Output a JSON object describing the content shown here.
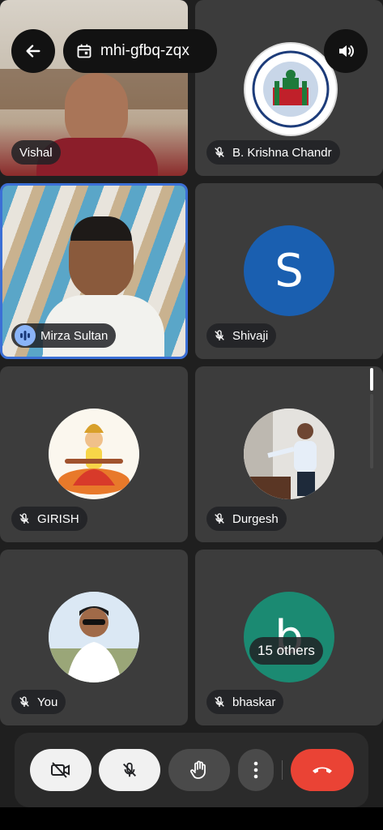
{
  "meeting": {
    "code": "mhi-gfbq-zqx"
  },
  "participants": [
    {
      "name": "Vishal",
      "type": "video"
    },
    {
      "name": "B. Krishna Chandr",
      "type": "logo",
      "muted": true
    },
    {
      "name": "Mirza Sultan",
      "type": "video",
      "speaking": true
    },
    {
      "name": "Shivaji",
      "type": "letter",
      "letter": "S",
      "muted": true
    },
    {
      "name": "GIRISH",
      "type": "photo",
      "muted": true
    },
    {
      "name": "Durgesh",
      "type": "photo",
      "muted": true
    },
    {
      "name": "You",
      "type": "photo",
      "muted": true
    },
    {
      "name": "bhaskar",
      "type": "letter",
      "letter": "b",
      "muted": true
    }
  ],
  "others_label": "15 others",
  "colors": {
    "tile_bg": "#3c3c3c",
    "shivaji_avatar": "#1a5fb0",
    "bhaskar_avatar": "#1b8a72",
    "active_border": "#3b6fd6",
    "end_call": "#ea4335"
  },
  "controls": {
    "camera": "camera-off-icon",
    "mic": "mic-off-icon",
    "hand": "raise-hand-icon",
    "more": "more-options-icon",
    "end": "end-call-icon"
  }
}
